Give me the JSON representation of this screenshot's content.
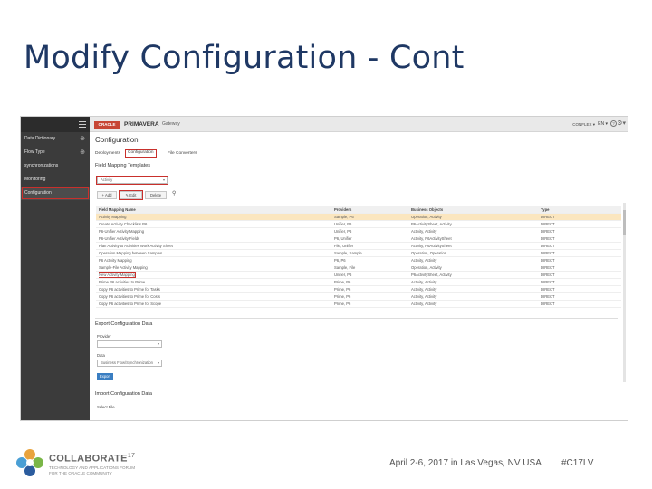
{
  "slide": {
    "title": "Modify Configuration - Cont"
  },
  "app": {
    "oracle_logo": "ORACLE",
    "brand": "PRIMAVERA",
    "brand_sub": "Gateway",
    "user": "CONFLEX ▾",
    "lang": "EN ▾",
    "help": "?",
    "gear": "⚙▾"
  },
  "sidebar": {
    "items": [
      {
        "label": "Data Dictionary",
        "plus": "⊕"
      },
      {
        "label": "Flow Type",
        "plus": "⊕"
      },
      {
        "label": "synchronizations",
        "plus": ""
      },
      {
        "label": "Monitoring",
        "plus": ""
      },
      {
        "label": "Configuration",
        "plus": ""
      }
    ]
  },
  "main": {
    "page_title": "Configuration",
    "tabs": [
      "Deployments",
      "Configuration",
      "File Converters"
    ],
    "field_mapping_title": "Field Mapping Templates",
    "template_select": "Activity",
    "buttons": {
      "add": "+ Add",
      "edit": "✎ Edit",
      "delete": "Delete"
    },
    "grid": {
      "headers": [
        "Field Mapping Name",
        "Providers",
        "Business Objects",
        "Type"
      ],
      "rows": [
        [
          "Activity Mapping",
          "Sample, P6",
          "Operation, Activity",
          "DIRECT"
        ],
        [
          "Create Activity Checklists P6",
          "Unifier, P6",
          "P6ActivitySheet, Activity",
          "DIRECT"
        ],
        [
          "P6-Unifier Activity Mapping",
          "Unifier, P6",
          "Activity, Activity",
          "DIRECT"
        ],
        [
          "P6-Unifier Activity Fields",
          "P6, Unifier",
          "Activity, P6ActivitySheet",
          "DIRECT"
        ],
        [
          "Plan Activity to Activities Work Activity Sheet",
          "File, Unifier",
          "Activity, P6ActivitySheet",
          "DIRECT"
        ],
        [
          "Operation Mapping between Samples",
          "Sample, Sample",
          "Operation, Operation",
          "DIRECT"
        ],
        [
          "P6 Activity Mapping",
          "P6, P6",
          "Activity, Activity",
          "DIRECT"
        ],
        [
          "Sample-File Activity Mapping",
          "Sample, File",
          "Operation, Activity",
          "DIRECT"
        ],
        [
          "New Activity Mapping",
          "Unifier, P6",
          "P6ActivitySheet, Activity",
          "DIRECT"
        ],
        [
          "Prime P6 activities to Prime",
          "Prime, P6",
          "Activity, Activity",
          "DIRECT"
        ],
        [
          "Copy P6 activities to Prime for Tasks",
          "Prime, P6",
          "Activity, Activity",
          "DIRECT"
        ],
        [
          "Copy P6 activities to Prime for Costs",
          "Prime, P6",
          "Activity, Activity",
          "DIRECT"
        ],
        [
          "Copy P6 activities to Prime for Scope",
          "Prime, P6",
          "Activity, Activity",
          "DIRECT"
        ]
      ]
    },
    "export": {
      "title": "Export Configuration Data",
      "provider_label": "Provider",
      "provider_value": "",
      "data_label": "Data",
      "data_value": "Business Flow/Synchronization",
      "export_button": "Export"
    },
    "import": {
      "title": "Import Configuration Data",
      "select_file_label": "Select File"
    }
  },
  "footer": {
    "brand": "COLLABORATE",
    "brand_year": "17",
    "tagline1": "TECHNOLOGY AND APPLICATIONS FORUM",
    "tagline2": "FOR THE ORACLE COMMUNITY",
    "event": "April 2-6, 2017 in Las Vegas, NV USA",
    "hashtag": "#C17LV"
  },
  "colors": {
    "title": "#1f3864",
    "highlight": "#c9302c",
    "selected_row": "#fbe6bf",
    "sidebar": "#3b3b3b",
    "oracle_red": "#c74634"
  }
}
